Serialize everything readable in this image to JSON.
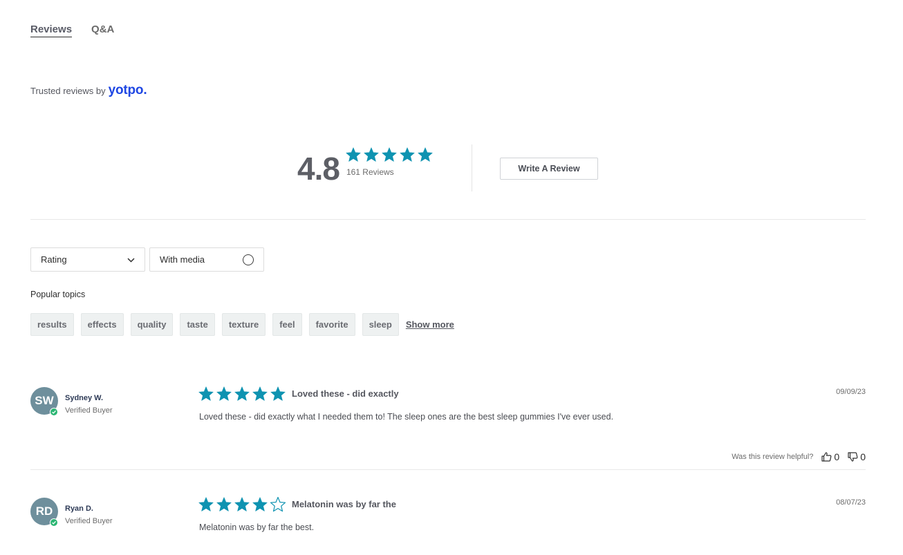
{
  "tabs": [
    {
      "label": "Reviews",
      "active": true
    },
    {
      "label": "Q&A",
      "active": false
    }
  ],
  "trusted": {
    "text": "Trusted reviews by",
    "brand": "yotpo."
  },
  "summary": {
    "average": "4.8",
    "average_value": 4.8,
    "stars": 5,
    "count_label": "161 Reviews",
    "star_color": "#0f93b1"
  },
  "write_review_label": "Write A Review",
  "filters": {
    "rating_label": "Rating",
    "media_label": "With media"
  },
  "popular_topics": {
    "label": "Popular topics",
    "items": [
      "results",
      "effects",
      "quality",
      "taste",
      "texture",
      "feel",
      "favorite",
      "sleep"
    ],
    "show_more": "Show more"
  },
  "reviews": [
    {
      "initials": "SW",
      "name": "Sydney W.",
      "tag": "Verified Buyer",
      "rating": 5,
      "title": "Loved these - did exactly",
      "date": "09/09/23",
      "body": "Loved these - did exactly what I needed them to! The sleep ones are the best sleep gummies I've ever used.",
      "helpful_label": "Was this review helpful?",
      "up_votes": "0",
      "down_votes": "0"
    },
    {
      "initials": "RD",
      "name": "Ryan D.",
      "tag": "Verified Buyer",
      "rating": 4,
      "title": "Melatonin was by far the",
      "date": "08/07/23",
      "body": "Melatonin was by far the best."
    }
  ]
}
